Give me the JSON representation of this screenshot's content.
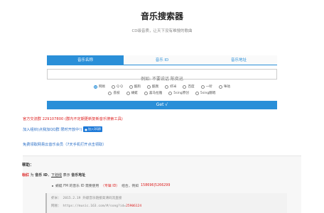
{
  "header": {
    "title": "音乐搜索器",
    "subtitle": "CD级音质，让天下没有难搜的歌曲"
  },
  "tabs": [
    {
      "label": "音乐名称",
      "active": true
    },
    {
      "label": "音乐 ID",
      "active": false
    },
    {
      "label": "音乐地址",
      "active": false
    }
  ],
  "search": {
    "placeholder": "例如: 不要说话 陈奕迅"
  },
  "sources": {
    "row1": [
      {
        "label": "网易",
        "checked": true
      },
      {
        "label": "Q Q",
        "checked": false
      },
      {
        "label": "酷狗",
        "checked": false
      },
      {
        "label": "酷我",
        "checked": false
      },
      {
        "label": "虾米",
        "checked": false
      },
      {
        "label": "百度",
        "checked": false
      },
      {
        "label": "一听",
        "checked": false
      },
      {
        "label": "咪咕",
        "checked": false
      }
    ],
    "row2": [
      {
        "label": "荔枝",
        "checked": false
      },
      {
        "label": "蜻蜓",
        "checked": false
      },
      {
        "label": "喜马拉雅",
        "checked": false
      },
      {
        "label": "5sing原创",
        "checked": false
      },
      {
        "label": "5sing翻唱",
        "checked": false
      }
    ]
  },
  "get_button": "Get √",
  "notices": {
    "red_notice": "官方交流群 229107800 (群内不定期更新复新音乐搜索工具)",
    "qq_text": "加入组织(点我加QQ群 限时开放中!)",
    "qq_badge": "加入QQ群",
    "vip_link": "免费领取网易云音乐会员（7天手机打开点击领取）"
  },
  "help": {
    "title": "帮助：",
    "example_red": "标红",
    "example_for": " 为 ",
    "example_id": "音乐 ID",
    "example_sep": "，",
    "example_underline": "下划线",
    "example_means": " 表示 ",
    "example_addr": "音乐地址",
    "bullet_prefix": "蜻蜓 FM 的音乐 ID 需要使用",
    "bullet_red1": "（专辑 ID）",
    "bullet_mid": " 组合，例如 ",
    "bullet_red2": "158696|5266299"
  },
  "code": {
    "line1": "虾米：  2015.2.19 升级音乐链接高清码流直接",
    "line2_prefix": "网易：  https://music.163.com/#/song?id=",
    "line2_red": "25906124"
  },
  "colors": {
    "accent": "#2a8fd8",
    "red": "#dd2222",
    "link": "#2a6fc7"
  }
}
